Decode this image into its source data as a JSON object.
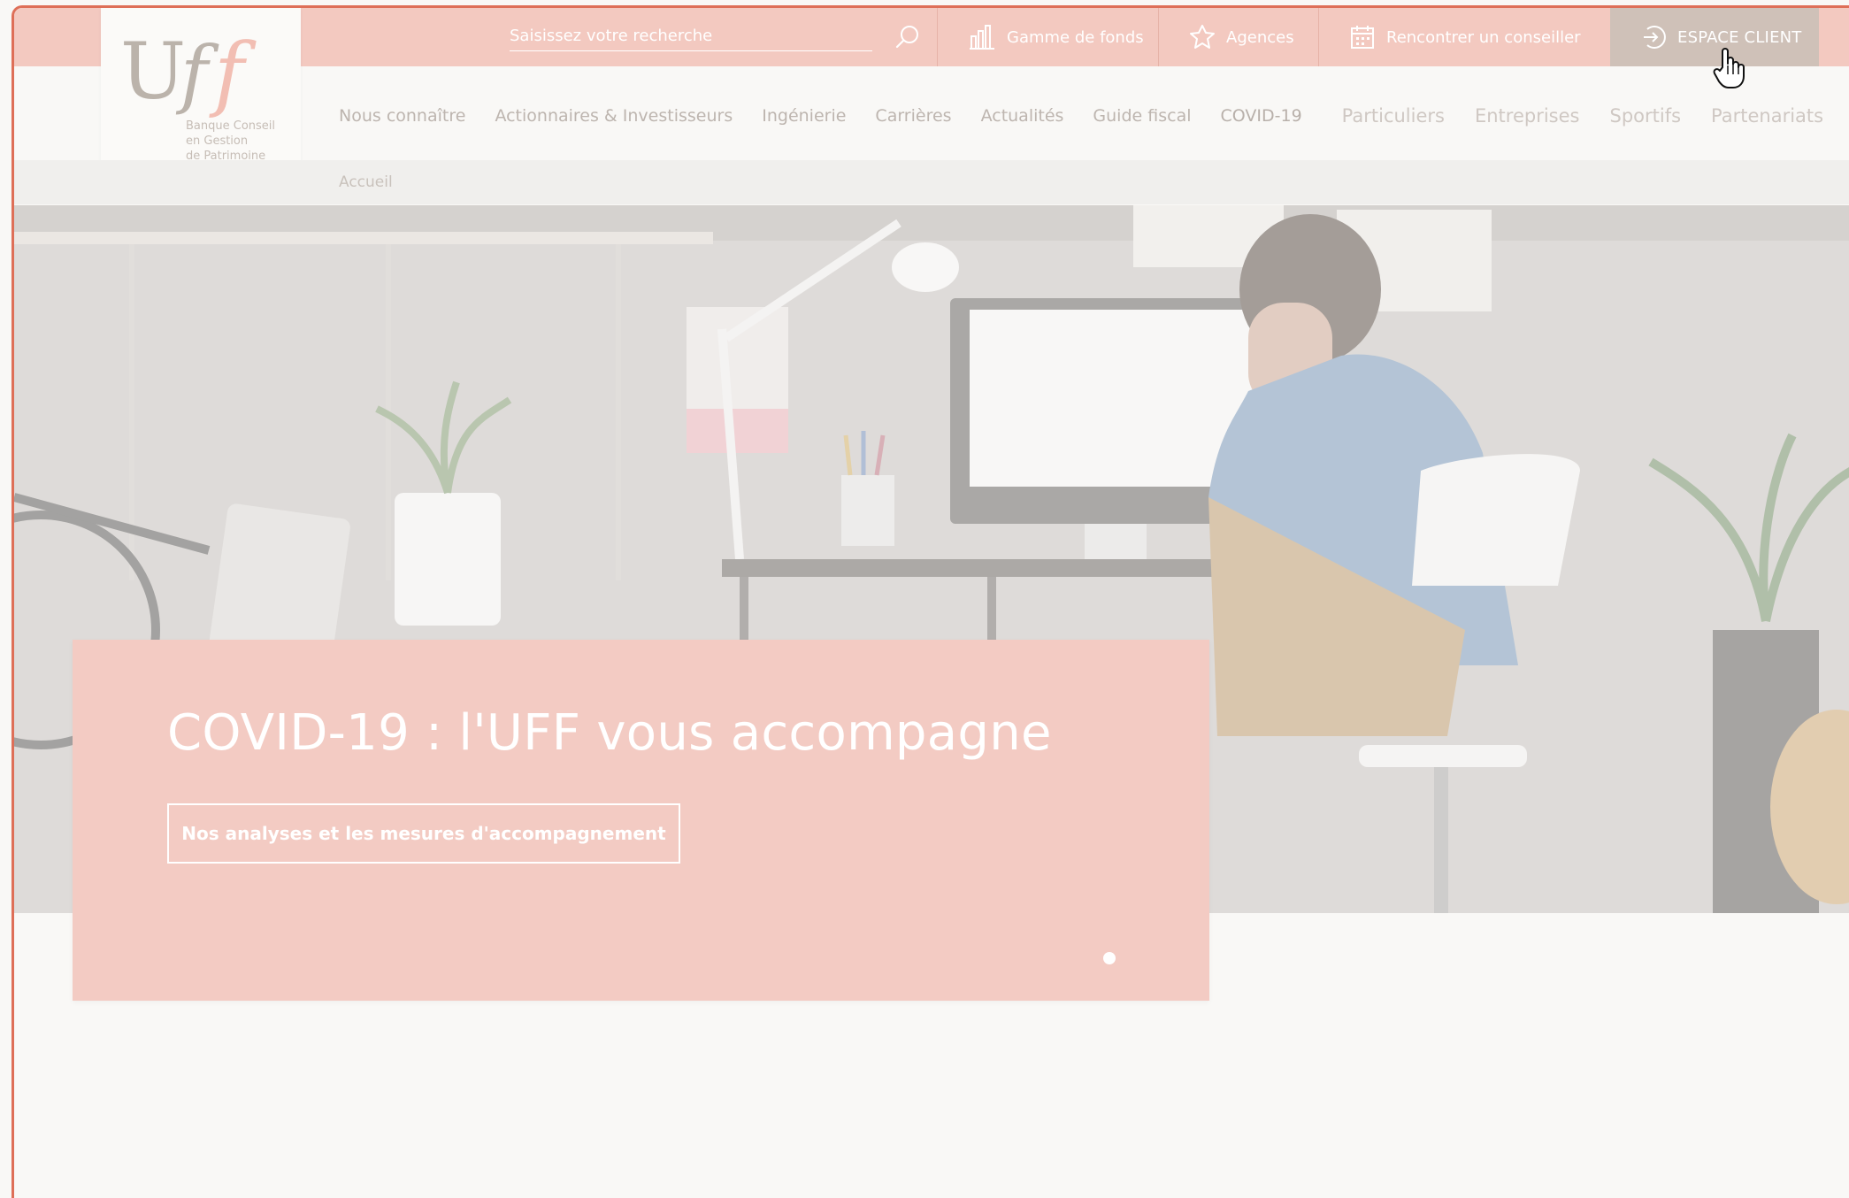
{
  "header": {
    "search": {
      "placeholder": "Saisissez votre recherche"
    },
    "utility_nav": [
      {
        "label": "Gamme de fonds",
        "icon": "chart-bars-icon"
      },
      {
        "label": "Agences",
        "icon": "star-badge-icon"
      },
      {
        "label": "Rencontrer un conseiller",
        "icon": "calendar-icon"
      },
      {
        "label": "ESPACE CLIENT",
        "icon": "login-arrow-icon"
      }
    ]
  },
  "logo": {
    "letters": [
      "U",
      "f",
      "f"
    ],
    "tagline": [
      "Banque Conseil",
      "en Gestion",
      "de Patrimoine"
    ]
  },
  "main_nav": {
    "items": [
      "Nous connaître",
      "Actionnaires & Investisseurs",
      "Ingénierie",
      "Carrières",
      "Actualités",
      "Guide fiscal",
      "COVID-19"
    ],
    "segments": [
      "Particuliers",
      "Entreprises",
      "Sportifs",
      "Partenariats"
    ]
  },
  "breadcrumb": {
    "current": "Accueil"
  },
  "hero": {
    "title": "COVID-19 : l'UFF vous accompagne",
    "button_label": "Nos analyses et les mesures d'accompagnement",
    "slide_count": 1,
    "active_slide": 1
  },
  "colors": {
    "accent": "#f3c9c0",
    "accent_strong": "#de6f58",
    "active_tab": "#cfc1b8",
    "page_bg": "#f9f8f6"
  }
}
